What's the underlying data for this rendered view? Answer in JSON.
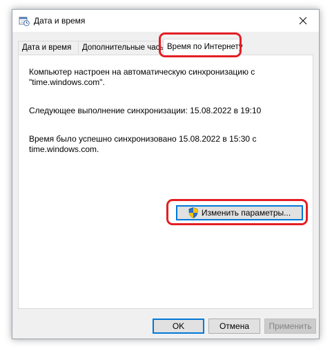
{
  "window": {
    "title": "Дата и время",
    "title_icon": "clock-calendar-icon",
    "close_icon": "close-icon"
  },
  "tabs": [
    {
      "label": "Дата и время",
      "active": false
    },
    {
      "label": "Дополнительные часы",
      "active": false
    },
    {
      "label": "Время по Интернету",
      "active": true
    }
  ],
  "panel": {
    "status_text": "Компьютер настроен на автоматическую синхронизацию с \"time.windows.com\".",
    "next_sync_text": "Следующее выполнение синхронизации: 15.08.2022 в 19:10",
    "last_sync_text": "Время было успешно синхронизовано 15.08.2022 в 15:30 с time.windows.com.",
    "change_button_label": "Изменить параметры...",
    "change_button_icon": "uac-shield-icon"
  },
  "footer": {
    "ok_label": "OK",
    "cancel_label": "Отмена",
    "apply_label": "Применить"
  },
  "colors": {
    "highlight": "#e31e24",
    "focus_border": "#0078d7",
    "dialog_bg": "#f0f0f0"
  }
}
